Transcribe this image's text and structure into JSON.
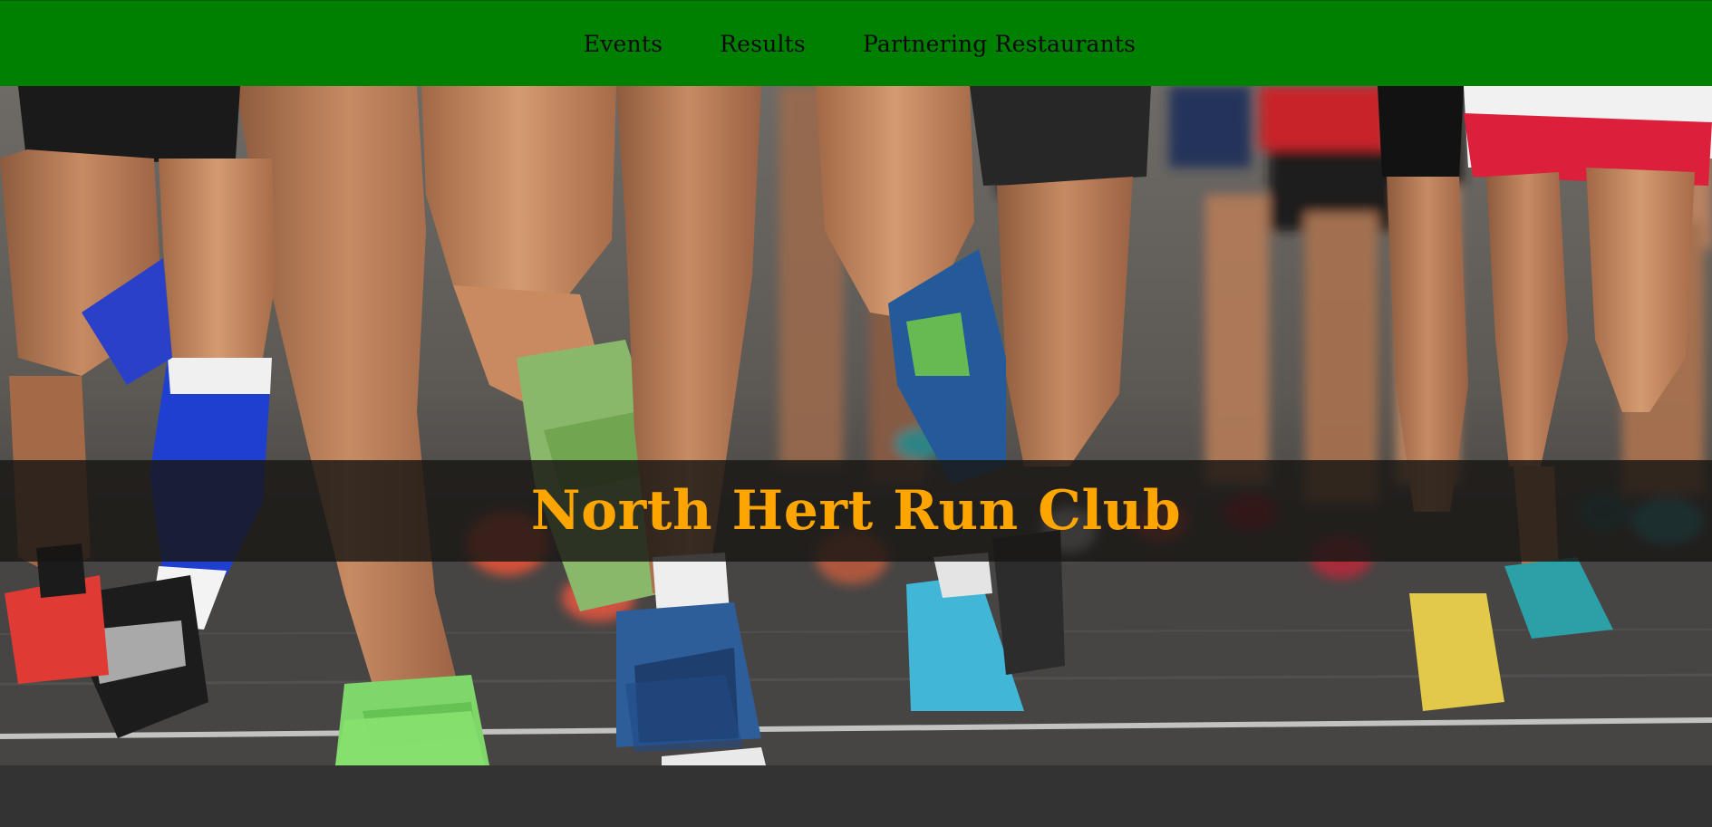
{
  "nav": {
    "items": [
      {
        "label": "Events"
      },
      {
        "label": "Results"
      },
      {
        "label": "Partnering Restaurants"
      }
    ]
  },
  "hero": {
    "title": "North Hert Run Club",
    "image_subject": "marathon-runners-legs-photo"
  },
  "colors": {
    "nav_background": "#008000",
    "nav_text": "#0b0b0b",
    "title_text": "#ffa500",
    "title_band": "#181614",
    "page_background": "#333333"
  }
}
